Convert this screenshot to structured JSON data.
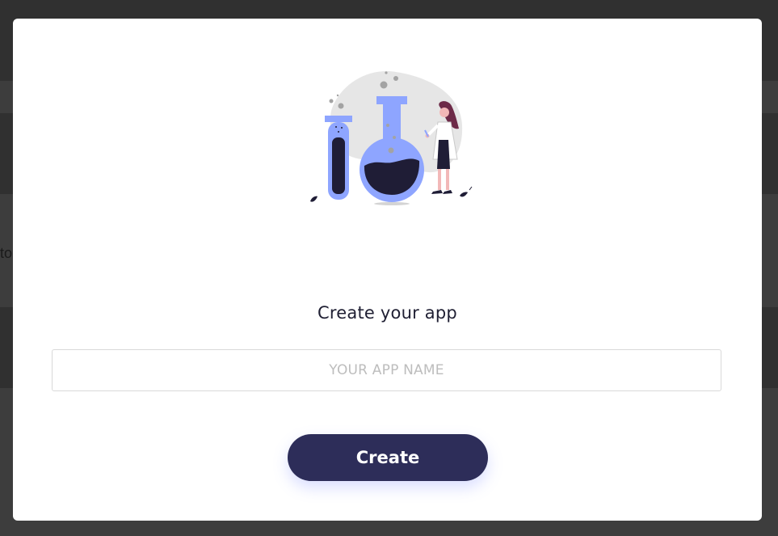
{
  "background": {
    "peek_text": "to"
  },
  "modal": {
    "title": "Create your app",
    "app_name_input": {
      "value": "",
      "placeholder": "YOUR APP NAME"
    },
    "create_label": "Create",
    "illustration": "scientist-with-flasks-illustration"
  },
  "colors": {
    "backdrop": "#3d3d3d",
    "modal_bg": "#ffffff",
    "button_bg": "#2d2d59",
    "button_text": "#ffffff",
    "flask_blue": "#8ea5ff",
    "liquid_dark": "#1f1d36",
    "blob_gray": "#e6e6e6"
  }
}
